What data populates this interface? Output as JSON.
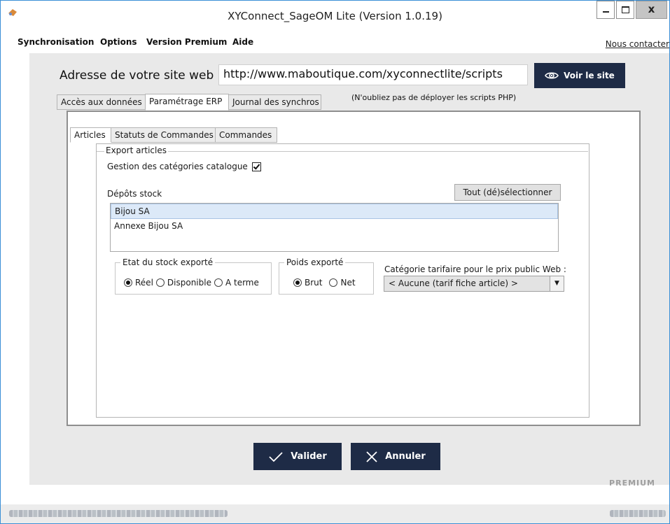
{
  "window": {
    "title": "XYConnect_SageOM Lite (Version 1.0.19)",
    "minimize_glyph": "—",
    "maximize_glyph": "□",
    "close_glyph": "x"
  },
  "menu": {
    "items": [
      "Synchronisation",
      "Options",
      "Version Premium",
      "Aide"
    ],
    "contact": "Nous contacter"
  },
  "site": {
    "label": "Adresse de votre site web :",
    "url": "http://www.maboutique.com/xyconnectlite/scripts",
    "voir_label": "Voir le site",
    "php_note": "(N'oubliez pas de déployer les scripts PHP)"
  },
  "tabs": [
    {
      "label": "Accès aux données"
    },
    {
      "label": "Paramétrage ERP"
    },
    {
      "label": "Journal des synchros"
    }
  ],
  "inner_tabs": [
    {
      "label": "Articles"
    },
    {
      "label": "Statuts de Commandes"
    },
    {
      "label": "Commandes"
    }
  ],
  "export": {
    "group_title": "Export articles",
    "gestion_label": "Gestion des catégories catalogue",
    "gestion_checked": true,
    "depots_label": "Dépôts stock",
    "toggle_select_label": "Tout (dé)sélectionner",
    "depots": [
      "Bijou SA",
      "Annexe Bijou SA"
    ],
    "selected_depot": "Bijou SA",
    "etat": {
      "title": "Etat du stock exporté",
      "options": [
        "Réel",
        "Disponible",
        "A terme"
      ],
      "selected": "Réel"
    },
    "poids": {
      "title": "Poids exporté",
      "options": [
        "Brut",
        "Net"
      ],
      "selected": "Brut"
    },
    "tarif": {
      "label": "Catégorie tarifaire pour le prix public Web :",
      "value": "< Aucune (tarif fiche article) >"
    }
  },
  "actions": {
    "valider": "Valider",
    "annuler": "Annuler"
  },
  "brand_text": "PREMIUM",
  "icons": {
    "app": "app-icon",
    "eye": "eye-icon",
    "check": "check-icon",
    "cross": "cross-icon",
    "dropdown": "chevron-down-icon"
  }
}
